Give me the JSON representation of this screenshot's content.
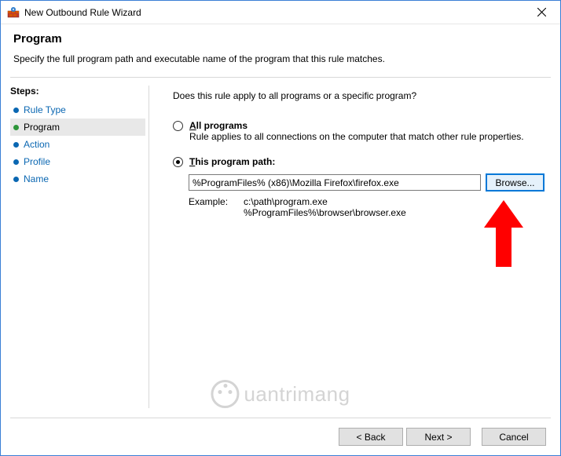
{
  "titlebar": {
    "title": "New Outbound Rule Wizard"
  },
  "header": {
    "title": "Program",
    "desc": "Specify the full program path and executable name of the program that this rule matches."
  },
  "sidebar": {
    "label": "Steps:",
    "items": [
      {
        "label": "Rule Type",
        "current": false
      },
      {
        "label": "Program",
        "current": true
      },
      {
        "label": "Action",
        "current": false
      },
      {
        "label": "Profile",
        "current": false
      },
      {
        "label": "Name",
        "current": false
      }
    ]
  },
  "main": {
    "prompt": "Does this rule apply to all programs or a specific program?",
    "option_all": {
      "prefix": "A",
      "rest": "ll programs",
      "desc": "Rule applies to all connections on the computer that match other rule properties."
    },
    "option_this": {
      "prefix": "T",
      "rest": "his program path:",
      "path_value": "%ProgramFiles% (x86)\\Mozilla Firefox\\firefox.exe",
      "browse_label": "Browse...",
      "example_label": "Example:",
      "example_text": "c:\\path\\program.exe\n%ProgramFiles%\\browser\\browser.exe"
    }
  },
  "buttons": {
    "back": "< Back",
    "next": "Next >",
    "cancel": "Cancel"
  },
  "watermark": "uantrimang"
}
